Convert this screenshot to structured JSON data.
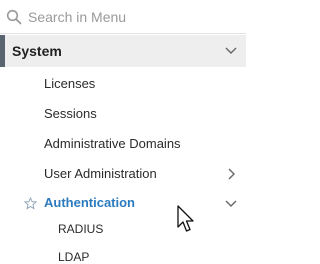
{
  "search": {
    "placeholder": "Search in Menu",
    "icon": "search-icon"
  },
  "section": {
    "label": "System",
    "icon": "chevron-down-icon"
  },
  "items": [
    {
      "label": "Licenses"
    },
    {
      "label": "Sessions"
    },
    {
      "label": "Administrative Domains"
    },
    {
      "label": "User Administration",
      "icon": "chevron-right-icon"
    }
  ],
  "auth": {
    "label": "Authentication",
    "star_icon": "star-icon",
    "chevron_icon": "chevron-down-icon",
    "accent": "#2c7bbf"
  },
  "auth_children": [
    {
      "label": "RADIUS"
    },
    {
      "label": "LDAP"
    }
  ]
}
